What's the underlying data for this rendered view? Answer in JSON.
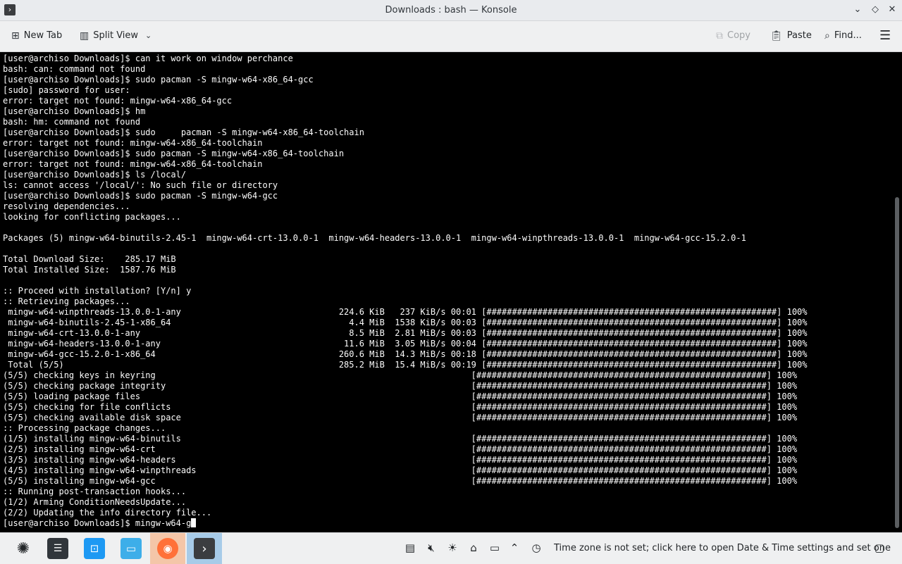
{
  "window": {
    "title": "Downloads : bash — Konsole",
    "app_icon": "terminal-icon",
    "controls": [
      "minimize-icon",
      "maximize-icon",
      "close-icon"
    ]
  },
  "toolbar": {
    "new_tab_label": "New Tab",
    "split_view_label": "Split View",
    "copy_label": "Copy",
    "paste_label": "Paste",
    "find_label": "Find...",
    "menu_icon": "hamburger-menu-icon"
  },
  "terminal": {
    "lines": [
      "[user@archiso Downloads]$ can it work on window perchance",
      "bash: can: command not found",
      "[user@archiso Downloads]$ sudo pacman -S mingw-w64-x86_64-gcc",
      "[sudo] password for user:",
      "error: target not found: mingw-w64-x86_64-gcc",
      "[user@archiso Downloads]$ hm",
      "bash: hm: command not found",
      "[user@archiso Downloads]$ sudo     pacman -S mingw-w64-x86_64-toolchain",
      "error: target not found: mingw-w64-x86_64-toolchain",
      "[user@archiso Downloads]$ sudo pacman -S mingw-w64-x86_64-toolchain",
      "error: target not found: mingw-w64-x86_64-toolchain",
      "[user@archiso Downloads]$ ls /local/",
      "ls: cannot access '/local/': No such file or directory",
      "[user@archiso Downloads]$ sudo pacman -S mingw-w64-gcc",
      "resolving dependencies...",
      "looking for conflicting packages...",
      "",
      "Packages (5) mingw-w64-binutils-2.45-1  mingw-w64-crt-13.0.0-1  mingw-w64-headers-13.0.0-1  mingw-w64-winpthreads-13.0.0-1  mingw-w64-gcc-15.2.0-1",
      "",
      "Total Download Size:    285.17 MiB",
      "Total Installed Size:  1587.76 MiB",
      "",
      ":: Proceed with installation? [Y/n] y",
      ":: Retrieving packages...",
      " mingw-w64-winpthreads-13.0.0-1-any                               224.6 KiB   237 KiB/s 00:01 [#########################################################] 100%",
      " mingw-w64-binutils-2.45-1-x86_64                                   4.4 MiB  1538 KiB/s 00:03 [#########################################################] 100%",
      " mingw-w64-crt-13.0.0-1-any                                         8.5 MiB  2.81 MiB/s 00:03 [#########################################################] 100%",
      " mingw-w64-headers-13.0.0-1-any                                    11.6 MiB  3.05 MiB/s 00:04 [#########################################################] 100%",
      " mingw-w64-gcc-15.2.0-1-x86_64                                    260.6 MiB  14.3 MiB/s 00:18 [#########################################################] 100%",
      " Total (5/5)                                                      285.2 MiB  15.4 MiB/s 00:19 [#########################################################] 100%",
      "(5/5) checking keys in keyring                                                              [#########################################################] 100%",
      "(5/5) checking package integrity                                                            [#########################################################] 100%",
      "(5/5) loading package files                                                                 [#########################################################] 100%",
      "(5/5) checking for file conflicts                                                           [#########################################################] 100%",
      "(5/5) checking available disk space                                                         [#########################################################] 100%",
      ":: Processing package changes...",
      "(1/5) installing mingw-w64-binutils                                                         [#########################################################] 100%",
      "(2/5) installing mingw-w64-crt                                                              [#########################################################] 100%",
      "(3/5) installing mingw-w64-headers                                                          [#########################################################] 100%",
      "(4/5) installing mingw-w64-winpthreads                                                      [#########################################################] 100%",
      "(5/5) installing mingw-w64-gcc                                                              [#########################################################] 100%",
      ":: Running post-transaction hooks...",
      "(1/2) Arming ConditionNeedsUpdate...",
      "(2/2) Updating the info directory file..."
    ],
    "prompt_line": "[user@archiso Downloads]$ mingw-w64-g"
  },
  "taskbar": {
    "apps": [
      {
        "name": "app-launcher-icon"
      },
      {
        "name": "system-settings-icon"
      },
      {
        "name": "discover-store-icon"
      },
      {
        "name": "dolphin-file-manager-icon"
      },
      {
        "name": "firefox-icon"
      },
      {
        "name": "konsole-icon"
      }
    ],
    "tray_icons": [
      "clipboard-icon",
      "volume-muted-icon",
      "brightness-icon",
      "usb-device-icon",
      "display-config-icon",
      "tray-expand-icon",
      "clock-warning-icon"
    ],
    "timezone_message": "Time zone is not set; click here to open Date & Time settings and set one",
    "show_desktop_icon": "show-desktop-icon"
  },
  "colors": {
    "terminal_bg": "#000000",
    "terminal_fg": "#fcfcfc",
    "chrome_bg": "#eff0f1",
    "active_task": "#a7cbe8",
    "firefox_accent": "#ff7139",
    "konsole_tile": "#3b3d40"
  }
}
